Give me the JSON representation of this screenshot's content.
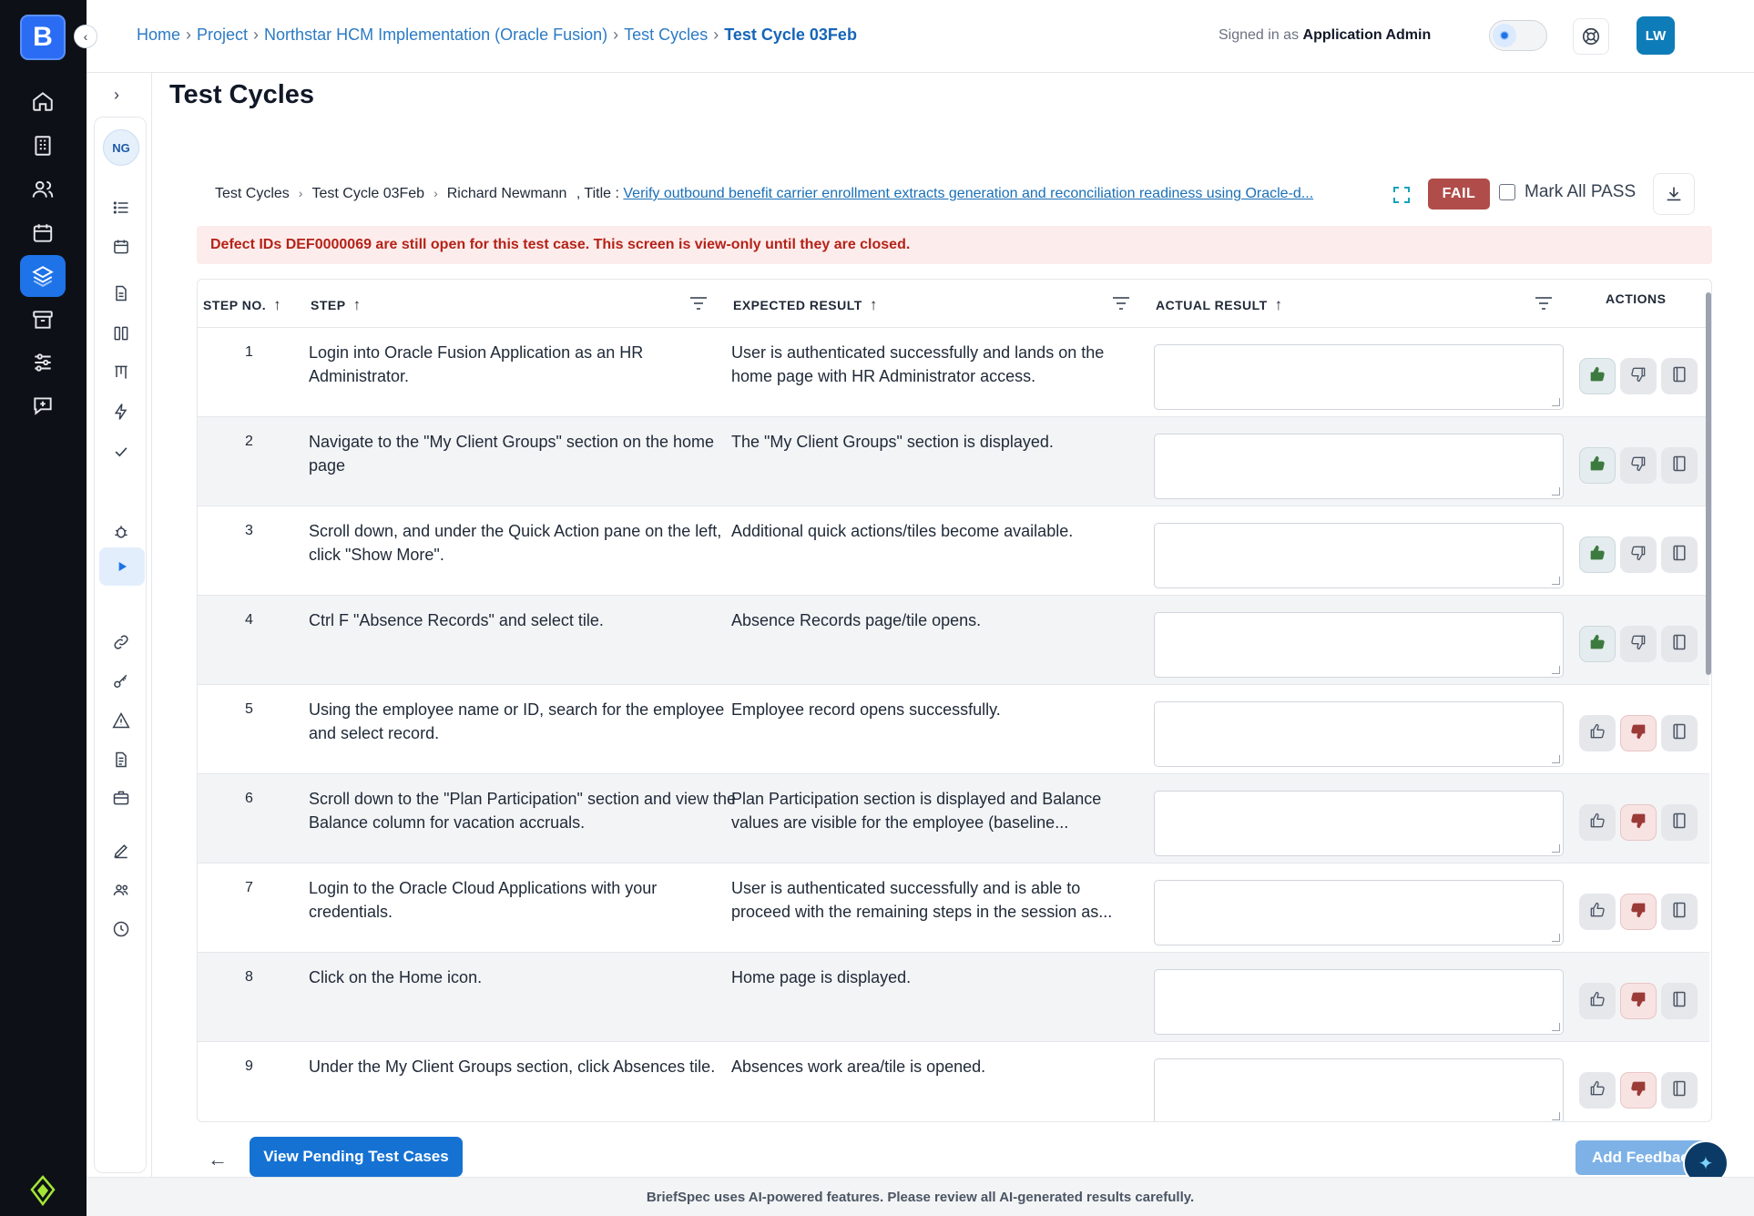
{
  "header": {
    "breadcrumb": [
      "Home",
      "Project",
      "Northstar HCM Implementation (Oracle Fusion)",
      "Test Cycles",
      "Test Cycle 03Feb"
    ],
    "signed_in_prefix": "Signed in as",
    "signed_in_user": "Application Admin",
    "user_initials": "LW"
  },
  "rail": {
    "logo": "B",
    "items": [
      "home-icon",
      "building-icon",
      "users-icon",
      "calendar-icon",
      "layers-icon",
      "archive-icon",
      "sliders-icon",
      "chat-plus-icon"
    ],
    "active_index": 4
  },
  "sidebar": {
    "avatar": "NG",
    "items": [
      "list-icon",
      "calendar-icon",
      "document-icon",
      "columns-icon",
      "board-icon",
      "bolt-icon",
      "check-icon",
      "play-icon",
      "bug-icon",
      "link-icon",
      "key-icon",
      "warning-icon",
      "file-icon",
      "briefcase-icon",
      "pen-icon",
      "team-icon",
      "clock-icon"
    ],
    "active_index": 7
  },
  "page_title": "Test Cycles",
  "subcrumbs": {
    "items": [
      "Test Cycles",
      "Test Cycle 03Feb",
      "Richard Newmann"
    ],
    "title_prefix": ", Title :",
    "title_link": "Verify outbound benefit carrier enrollment extracts generation and reconciliation readiness using Oracle-d..."
  },
  "status_badge": "FAIL",
  "mark_all_label": "Mark All PASS",
  "alert": "Defect IDs DEF0000069 are still open for this test case. This screen is view-only until they are closed.",
  "table": {
    "columns": {
      "step_no": "STEP NO.",
      "step": "STEP",
      "expected": "EXPECTED RESULT",
      "actual": "ACTUAL RESULT",
      "actions": "ACTIONS"
    },
    "rows": [
      {
        "no": "1",
        "step": "Login into Oracle Fusion Application as an HR Administrator.",
        "expected": "User is authenticated successfully and lands on the home page with HR Administrator access.",
        "actual": "",
        "result": "pass"
      },
      {
        "no": "2",
        "step": "Navigate to the \"My Client Groups\" section on the home page",
        "expected": "The \"My Client Groups\" section is displayed.",
        "actual": "",
        "result": "pass"
      },
      {
        "no": "3",
        "step": "Scroll down, and under the Quick Action pane on the left, click \"Show More\".",
        "expected": "Additional quick actions/tiles become available.",
        "actual": "",
        "result": "pass"
      },
      {
        "no": "4",
        "step": "Ctrl F \"Absence Records\" and select tile.",
        "expected": "Absence Records page/tile opens.",
        "actual": "",
        "result": "pass"
      },
      {
        "no": "5",
        "step": "Using the employee name or ID, search for the employee and select record.",
        "expected": "Employee record opens successfully.",
        "actual": "",
        "result": "fail"
      },
      {
        "no": "6",
        "step": "Scroll down to the \"Plan Participation\" section and view the Balance column for vacation accruals.",
        "expected": "Plan Participation section is displayed and Balance values are visible for the employee (baseline...",
        "actual": "",
        "result": "fail"
      },
      {
        "no": "7",
        "step": "Login to the Oracle Cloud Applications with your credentials.",
        "expected": "User is authenticated successfully and is able to proceed with the remaining steps in the session as...",
        "actual": "",
        "result": "fail"
      },
      {
        "no": "8",
        "step": "Click on the Home icon.",
        "expected": "Home page is displayed.",
        "actual": "",
        "result": "fail"
      },
      {
        "no": "9",
        "step": "Under the My Client Groups section, click Absences tile.",
        "expected": "Absences work area/tile is opened.",
        "actual": "",
        "result": "fail"
      }
    ]
  },
  "footer": {
    "pending_button": "View Pending Test Cases",
    "feedback_button": "Add Feedback",
    "disclaimer": "BriefSpec uses AI-powered features. Please review all AI-generated results carefully."
  },
  "colors": {
    "primary": "#1572d3",
    "rail_bg": "#0d1117",
    "fail_badge": "#b04d4a",
    "pass_green": "#3d7a3f",
    "fail_red": "#9b3b38",
    "alert_bg": "#fdecec",
    "alert_text": "#b42318"
  }
}
